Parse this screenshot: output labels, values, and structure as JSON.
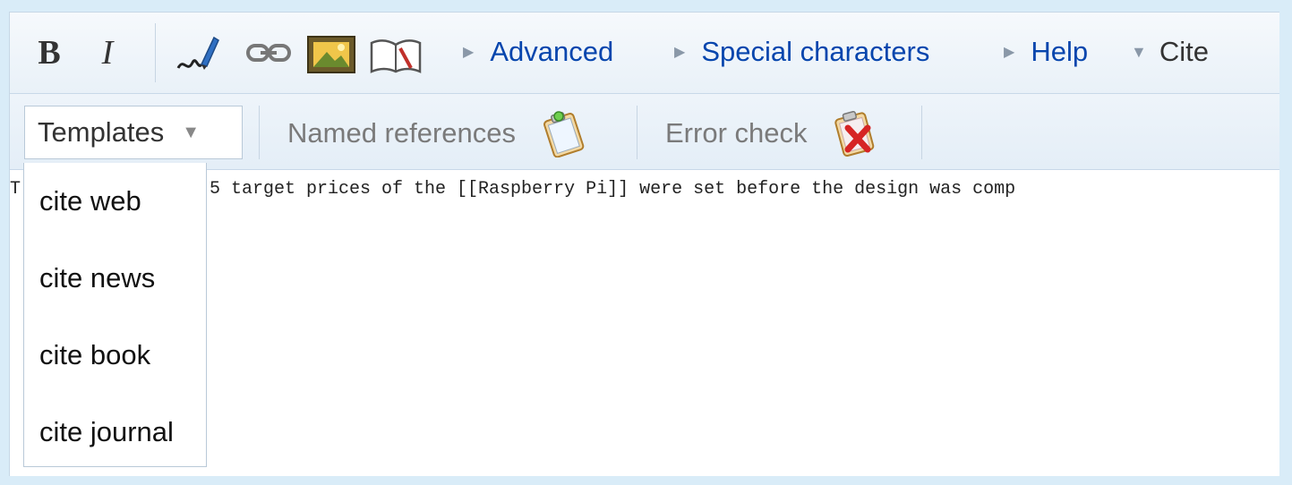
{
  "toolbar": {
    "bold_label": "B",
    "italic_label": "I",
    "icons": [
      "signature-icon",
      "link-icon",
      "image-icon",
      "reference-icon"
    ],
    "menus": [
      {
        "label": "Advanced",
        "state": "collapsed"
      },
      {
        "label": "Special characters",
        "state": "collapsed"
      },
      {
        "label": "Help",
        "state": "collapsed"
      },
      {
        "label": "Cite",
        "state": "expanded"
      }
    ]
  },
  "cite_toolbar": {
    "templates_label": "Templates",
    "named_references_label": "Named references",
    "error_check_label": "Error check"
  },
  "templates_dropdown": {
    "items": [
      "cite web",
      "cite news",
      "cite book",
      "cite journal"
    ]
  },
  "editor": {
    "text_prefix": "T",
    "text_visible": "5 target prices of the [[Raspberry Pi]] were set before the design was comp"
  },
  "colors": {
    "link": "#0645ad",
    "background": "#d9ecf8",
    "toolbar": "#e9f1f8"
  }
}
